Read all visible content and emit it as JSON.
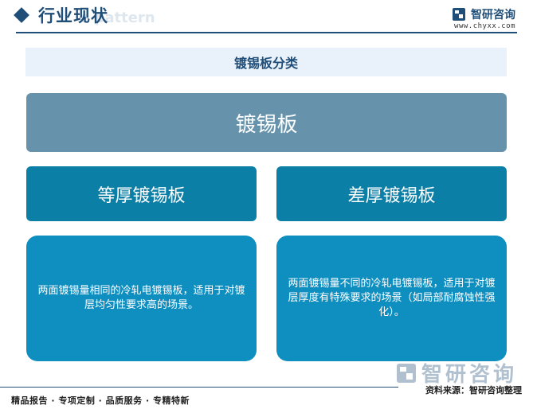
{
  "header": {
    "title": "行业现状",
    "ghost_text": "e pattern",
    "brand_name": "智研咨询",
    "brand_url": "www.chyxx.com"
  },
  "diagram": {
    "section_title": "镀锡板分类",
    "root": "镀锡板",
    "categories": [
      {
        "label": "等厚镀锡板",
        "description": "两面镀锡量相同的冷轧电镀锡板，适用于对镀层均匀性要求高的场景。"
      },
      {
        "label": "差厚镀锡板",
        "description": "两面镀锡量不同的冷轧电镀锡板，适用于对镀层厚度有特殊要求的场景（如局部耐腐蚀性强化）。"
      }
    ]
  },
  "watermark": {
    "text": "智研咨询"
  },
  "footer": {
    "source": "资料来源：智研咨询整理",
    "tags": "精品报告 · 专项定制 · 品质服务 · 专精特新"
  },
  "colors": {
    "primary": "#1f4e79",
    "root_box": "#6693ab",
    "category_box": "#0c7fa7",
    "description_box": "#0f8ec0",
    "section_bg": "#e9f1fa"
  }
}
